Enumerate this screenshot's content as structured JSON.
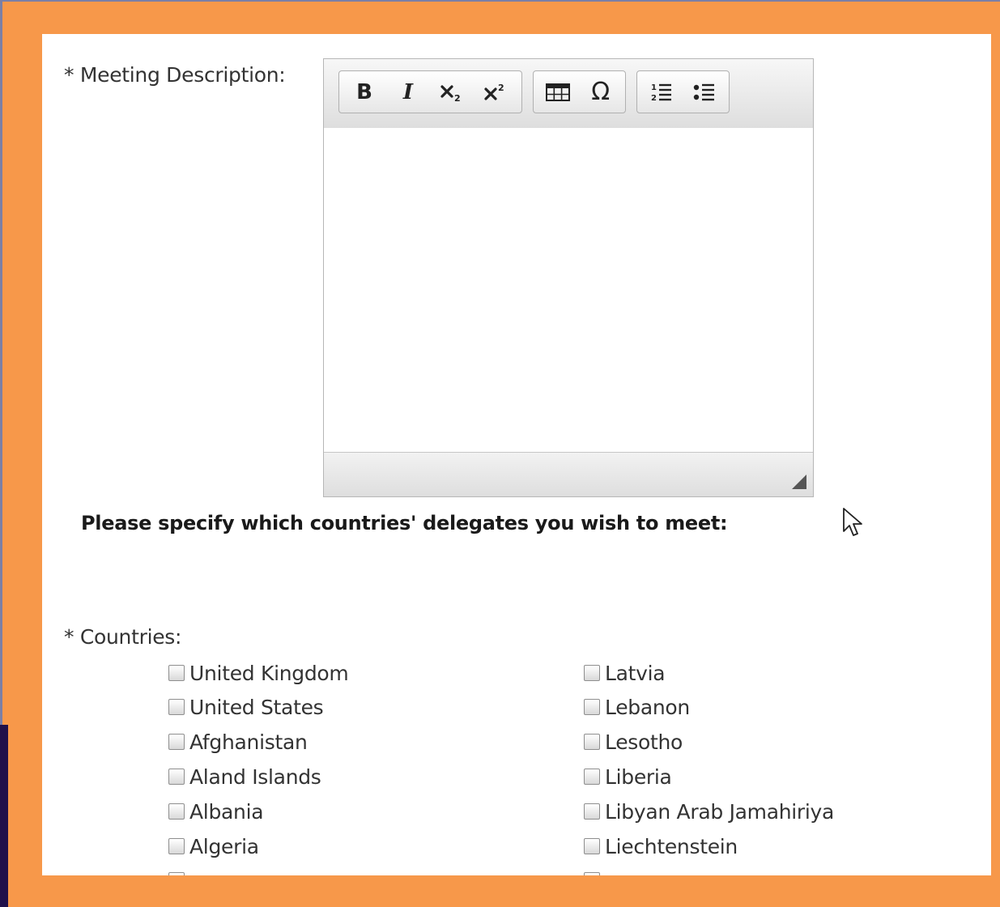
{
  "form": {
    "description_label": "* Meeting Description:",
    "instruction": "Please specify which countries' delegates you wish to meet:",
    "countries_label": "* Countries:"
  },
  "editor": {
    "toolbar": {
      "bold": "B",
      "italic": "I",
      "subscript_icon": "subscript-icon",
      "superscript_icon": "superscript-icon",
      "table_icon": "table-icon",
      "special_char": "Ω",
      "numbered_list_icon": "numbered-list-icon",
      "bulleted_list_icon": "bulleted-list-icon"
    },
    "content": ""
  },
  "countries": {
    "column1": [
      {
        "name": "United Kingdom",
        "checked": false
      },
      {
        "name": "United States",
        "checked": false
      },
      {
        "name": "Afghanistan",
        "checked": false
      },
      {
        "name": "Aland Islands",
        "checked": false
      },
      {
        "name": "Albania",
        "checked": false
      },
      {
        "name": "Algeria",
        "checked": false
      }
    ],
    "column2": [
      {
        "name": "Latvia",
        "checked": false
      },
      {
        "name": "Lebanon",
        "checked": false
      },
      {
        "name": "Lesotho",
        "checked": false
      },
      {
        "name": "Liberia",
        "checked": false
      },
      {
        "name": "Libyan Arab Jamahiriya",
        "checked": false
      },
      {
        "name": "Liechtenstein",
        "checked": false
      }
    ]
  },
  "colors": {
    "frame": "#f7984a",
    "panel": "#ffffff",
    "text": "#333333"
  }
}
